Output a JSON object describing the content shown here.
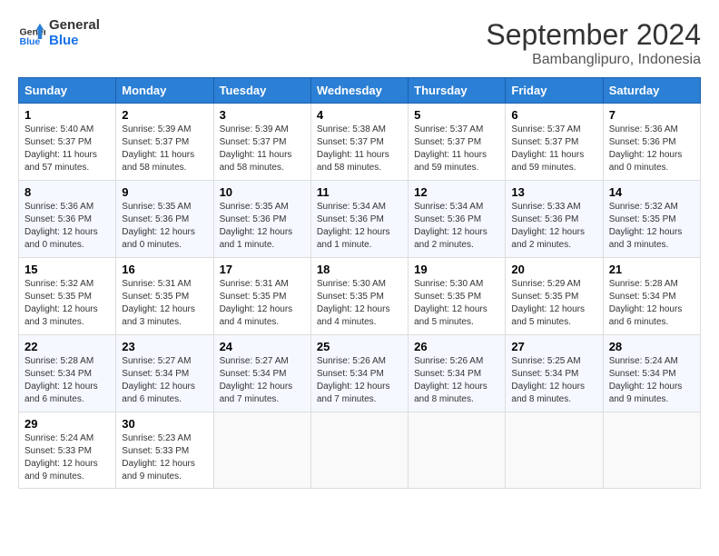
{
  "header": {
    "logo_line1": "General",
    "logo_line2": "Blue",
    "month": "September 2024",
    "location": "Bambanglipuro, Indonesia"
  },
  "weekdays": [
    "Sunday",
    "Monday",
    "Tuesday",
    "Wednesday",
    "Thursday",
    "Friday",
    "Saturday"
  ],
  "weeks": [
    [
      {
        "day": "1",
        "sunrise": "5:40 AM",
        "sunset": "5:37 PM",
        "daylight": "11 hours and 57 minutes."
      },
      {
        "day": "2",
        "sunrise": "5:39 AM",
        "sunset": "5:37 PM",
        "daylight": "11 hours and 58 minutes."
      },
      {
        "day": "3",
        "sunrise": "5:39 AM",
        "sunset": "5:37 PM",
        "daylight": "11 hours and 58 minutes."
      },
      {
        "day": "4",
        "sunrise": "5:38 AM",
        "sunset": "5:37 PM",
        "daylight": "11 hours and 58 minutes."
      },
      {
        "day": "5",
        "sunrise": "5:37 AM",
        "sunset": "5:37 PM",
        "daylight": "11 hours and 59 minutes."
      },
      {
        "day": "6",
        "sunrise": "5:37 AM",
        "sunset": "5:37 PM",
        "daylight": "11 hours and 59 minutes."
      },
      {
        "day": "7",
        "sunrise": "5:36 AM",
        "sunset": "5:36 PM",
        "daylight": "12 hours and 0 minutes."
      }
    ],
    [
      {
        "day": "8",
        "sunrise": "5:36 AM",
        "sunset": "5:36 PM",
        "daylight": "12 hours and 0 minutes."
      },
      {
        "day": "9",
        "sunrise": "5:35 AM",
        "sunset": "5:36 PM",
        "daylight": "12 hours and 0 minutes."
      },
      {
        "day": "10",
        "sunrise": "5:35 AM",
        "sunset": "5:36 PM",
        "daylight": "12 hours and 1 minute."
      },
      {
        "day": "11",
        "sunrise": "5:34 AM",
        "sunset": "5:36 PM",
        "daylight": "12 hours and 1 minute."
      },
      {
        "day": "12",
        "sunrise": "5:34 AM",
        "sunset": "5:36 PM",
        "daylight": "12 hours and 2 minutes."
      },
      {
        "day": "13",
        "sunrise": "5:33 AM",
        "sunset": "5:36 PM",
        "daylight": "12 hours and 2 minutes."
      },
      {
        "day": "14",
        "sunrise": "5:32 AM",
        "sunset": "5:35 PM",
        "daylight": "12 hours and 3 minutes."
      }
    ],
    [
      {
        "day": "15",
        "sunrise": "5:32 AM",
        "sunset": "5:35 PM",
        "daylight": "12 hours and 3 minutes."
      },
      {
        "day": "16",
        "sunrise": "5:31 AM",
        "sunset": "5:35 PM",
        "daylight": "12 hours and 3 minutes."
      },
      {
        "day": "17",
        "sunrise": "5:31 AM",
        "sunset": "5:35 PM",
        "daylight": "12 hours and 4 minutes."
      },
      {
        "day": "18",
        "sunrise": "5:30 AM",
        "sunset": "5:35 PM",
        "daylight": "12 hours and 4 minutes."
      },
      {
        "day": "19",
        "sunrise": "5:30 AM",
        "sunset": "5:35 PM",
        "daylight": "12 hours and 5 minutes."
      },
      {
        "day": "20",
        "sunrise": "5:29 AM",
        "sunset": "5:35 PM",
        "daylight": "12 hours and 5 minutes."
      },
      {
        "day": "21",
        "sunrise": "5:28 AM",
        "sunset": "5:34 PM",
        "daylight": "12 hours and 6 minutes."
      }
    ],
    [
      {
        "day": "22",
        "sunrise": "5:28 AM",
        "sunset": "5:34 PM",
        "daylight": "12 hours and 6 minutes."
      },
      {
        "day": "23",
        "sunrise": "5:27 AM",
        "sunset": "5:34 PM",
        "daylight": "12 hours and 6 minutes."
      },
      {
        "day": "24",
        "sunrise": "5:27 AM",
        "sunset": "5:34 PM",
        "daylight": "12 hours and 7 minutes."
      },
      {
        "day": "25",
        "sunrise": "5:26 AM",
        "sunset": "5:34 PM",
        "daylight": "12 hours and 7 minutes."
      },
      {
        "day": "26",
        "sunrise": "5:26 AM",
        "sunset": "5:34 PM",
        "daylight": "12 hours and 8 minutes."
      },
      {
        "day": "27",
        "sunrise": "5:25 AM",
        "sunset": "5:34 PM",
        "daylight": "12 hours and 8 minutes."
      },
      {
        "day": "28",
        "sunrise": "5:24 AM",
        "sunset": "5:34 PM",
        "daylight": "12 hours and 9 minutes."
      }
    ],
    [
      {
        "day": "29",
        "sunrise": "5:24 AM",
        "sunset": "5:33 PM",
        "daylight": "12 hours and 9 minutes."
      },
      {
        "day": "30",
        "sunrise": "5:23 AM",
        "sunset": "5:33 PM",
        "daylight": "12 hours and 9 minutes."
      },
      null,
      null,
      null,
      null,
      null
    ]
  ]
}
